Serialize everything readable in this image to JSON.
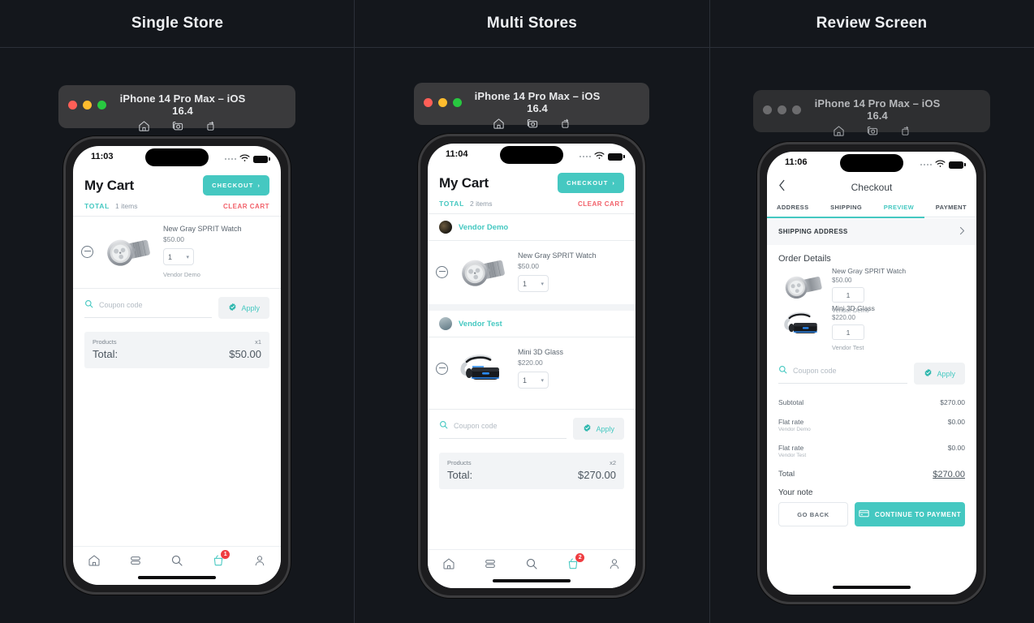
{
  "columns": [
    {
      "header": "Single Store"
    },
    {
      "header": "Multi Stores"
    },
    {
      "header": "Review Screen"
    }
  ],
  "simulator": {
    "title": "iPhone 14 Pro Max – iOS 16.4",
    "tools": [
      "home-icon",
      "screenshot-icon",
      "rotate-icon"
    ]
  },
  "phone1": {
    "status": {
      "time": "11:03"
    },
    "header": {
      "title": "My Cart",
      "checkout_label": "CHECKOUT"
    },
    "totals_line": {
      "total_label": "TOTAL",
      "items": "1 items",
      "clear": "CLEAR CART"
    },
    "items": [
      {
        "name": "New Gray SPRIT Watch",
        "price": "$50.00",
        "qty": "1",
        "vendor": "Vendor Demo",
        "image": "watch-thumbnail"
      }
    ],
    "coupon": {
      "placeholder": "Coupon code",
      "value": "",
      "apply_label": "Apply"
    },
    "summary": {
      "products_label": "Products",
      "count": "x1",
      "total_label": "Total:",
      "total_value": "$50.00"
    },
    "tabbar": {
      "cart_badge": "1",
      "items": [
        "home-icon",
        "layers-icon",
        "search-icon",
        "cart-icon",
        "profile-icon"
      ]
    }
  },
  "phone2": {
    "status": {
      "time": "11:04"
    },
    "header": {
      "title": "My Cart",
      "checkout_label": "CHECKOUT"
    },
    "totals_line": {
      "total_label": "TOTAL",
      "items": "2 items",
      "clear": "CLEAR CART"
    },
    "groups": [
      {
        "vendor": "Vendor Demo",
        "avatar": "vendor-demo-avatar",
        "item": {
          "name": "New Gray SPRIT Watch",
          "price": "$50.00",
          "qty": "1",
          "image": "watch-thumbnail"
        }
      },
      {
        "vendor": "Vendor Test",
        "avatar": "vendor-test-avatar",
        "item": {
          "name": "Mini 3D Glass",
          "price": "$220.00",
          "qty": "1",
          "image": "vr-headset-thumbnail"
        }
      }
    ],
    "coupon": {
      "placeholder": "Coupon code",
      "value": "",
      "apply_label": "Apply"
    },
    "summary": {
      "products_label": "Products",
      "count": "x2",
      "total_label": "Total:",
      "total_value": "$270.00"
    },
    "tabbar": {
      "cart_badge": "2",
      "items": [
        "home-icon",
        "layers-icon",
        "search-icon",
        "cart-icon",
        "profile-icon"
      ]
    }
  },
  "phone3": {
    "status": {
      "time": "11:06"
    },
    "header": {
      "title": "Checkout"
    },
    "tabs": [
      {
        "label": "ADDRESS",
        "active": false
      },
      {
        "label": "SHIPPING",
        "active": false
      },
      {
        "label": "PREVIEW",
        "active": true
      },
      {
        "label": "PAYMENT",
        "active": false
      }
    ],
    "shipping_address_label": "SHIPPING ADDRESS",
    "order_details_title": "Order Details",
    "order_items": [
      {
        "name": "New Gray SPRIT Watch",
        "price": "$50.00",
        "qty": "1",
        "vendor": "Vendor Demo",
        "image": "watch-thumbnail"
      },
      {
        "name": "Mini 3D Glass",
        "price": "$220.00",
        "qty": "1",
        "vendor": "Vendor Test",
        "image": "vr-headset-thumbnail"
      }
    ],
    "coupon": {
      "placeholder": "Coupon code",
      "value": "",
      "apply_label": "Apply"
    },
    "totals": [
      {
        "label": "Subtotal",
        "sub": "",
        "value": "$270.00"
      },
      {
        "label": "Flat rate",
        "sub": "Vendor Demo",
        "value": "$0.00"
      },
      {
        "label": "Flat rate",
        "sub": "Vendor Test",
        "value": "$0.00"
      }
    ],
    "grand_total": {
      "label": "Total",
      "value": "$270.00"
    },
    "note_label": "Your note",
    "actions": {
      "back_label": "GO BACK",
      "continue_label": "CONTINUE TO PAYMENT"
    }
  },
  "colors": {
    "accent_teal": "#45c8c1",
    "danger_red": "#f2616a",
    "badge_red": "#ef3d41",
    "page_bg": "#14171c",
    "divider": "#2b3038"
  }
}
